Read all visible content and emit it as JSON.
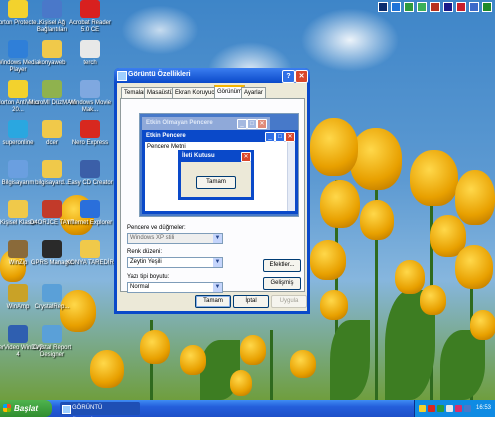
{
  "desktop": {
    "icons": [
      {
        "label": "Norton Protecte...",
        "icon": "norton-icon",
        "color": "#f3d22d"
      },
      {
        "label": "Kişisel Ağ Bağlantıları",
        "icon": "network-icon",
        "color": "#4a78c9"
      },
      {
        "label": "Acrobat Reader 5.0 CE",
        "icon": "acrobat-icon",
        "color": "#d8201f"
      },
      {
        "label": "Windows Media Player",
        "icon": "media-player-icon",
        "color": "#2f7fd8"
      },
      {
        "label": "konyaweb",
        "icon": "folder-icon",
        "color": "#f0c94a"
      },
      {
        "label": "terch",
        "icon": "document-icon",
        "color": "#e8e8e8"
      },
      {
        "label": "Norton AntiVirus 20...",
        "icon": "antivirus-icon",
        "color": "#f3d22d"
      },
      {
        "label": "MicroMI DüzMAN",
        "icon": "app-icon",
        "color": "#8fb24e"
      },
      {
        "label": "Windows Movie Mak...",
        "icon": "movie-icon",
        "color": "#7fa8e0"
      },
      {
        "label": "superonline",
        "icon": "globe-icon",
        "color": "#2aa7e0"
      },
      {
        "label": "dcer",
        "icon": "folder-icon",
        "color": "#f0c94a"
      },
      {
        "label": "Nero Express",
        "icon": "nero-icon",
        "color": "#d8281f"
      },
      {
        "label": "Bilgisayarım",
        "icon": "computer-icon",
        "color": "#6a9fe0"
      },
      {
        "label": "bilgisayard...",
        "icon": "folder-icon",
        "color": "#f0c94a"
      },
      {
        "label": "Easy CD Creator",
        "icon": "cd-icon",
        "color": "#3b5fa8"
      },
      {
        "label": "Kişisel Klasör",
        "icon": "folder-icon",
        "color": "#f0c94a"
      },
      {
        "label": "D4ORJCE TAYT",
        "icon": "app-icon",
        "color": "#c23a2a"
      },
      {
        "label": "Internet Explorer",
        "icon": "ie-icon",
        "color": "#2a6fdb"
      },
      {
        "label": "WinZip",
        "icon": "winzip-icon",
        "color": "#8a6a3a"
      },
      {
        "label": "GPRS Manager",
        "icon": "gprs-icon",
        "color": "#2a2a2a"
      },
      {
        "label": "KONYA TAREDİR",
        "icon": "folder-icon",
        "color": "#f0c94a"
      },
      {
        "label": "WinAmp",
        "icon": "winamp-icon",
        "color": "#c9a227"
      },
      {
        "label": "CrystalRep...",
        "icon": "crystal-icon",
        "color": "#5aa0d8"
      },
      {
        "label": "InterVideo WinDVD 4",
        "icon": "dvd-icon",
        "color": "#2f5fb0"
      },
      {
        "label": "Crystal Report Designer",
        "icon": "crystal-icon",
        "color": "#5aa0d8"
      }
    ]
  },
  "dialog": {
    "title": "Görüntü Özellikleri",
    "help_label": "?",
    "close_label": "✕",
    "tabs": [
      "Temalar",
      "Masaüstü",
      "Ekran Koruyucu",
      "Görünüm",
      "Ayarlar"
    ],
    "active_tab": "Görünüm",
    "preview": {
      "inactive_window_title": "Etkin Olmayan Pencere",
      "active_window_title": "Etkin Pencere",
      "window_text": "Pencere Metni",
      "message_box_title": "İleti Kutusu",
      "ok_label": "Tamam"
    },
    "fields": {
      "windows_buttons_label": "Pencere ve düğmeler:",
      "windows_buttons_value": "Windows XP stili",
      "color_scheme_label": "Renk düzeni:",
      "color_scheme_value": "Zeytin Yeşili",
      "font_size_label": "Yazı tipi boyutu:",
      "font_size_value": "Normal"
    },
    "side_buttons": {
      "effects": "Efektler...",
      "advanced": "Gelişmiş"
    },
    "bottom_buttons": {
      "ok": "Tamam",
      "cancel": "İptal",
      "apply": "Uygula"
    }
  },
  "taskbar": {
    "start_label": "Başlat",
    "task_button_label": "GÖRÜNTÜ ÖZELLİKLE...",
    "clock": "16:53"
  },
  "colors": {
    "xp_blue": "#0a49c9",
    "start_green": "#2f8d2e",
    "dialog_bg": "#ece9d8"
  }
}
